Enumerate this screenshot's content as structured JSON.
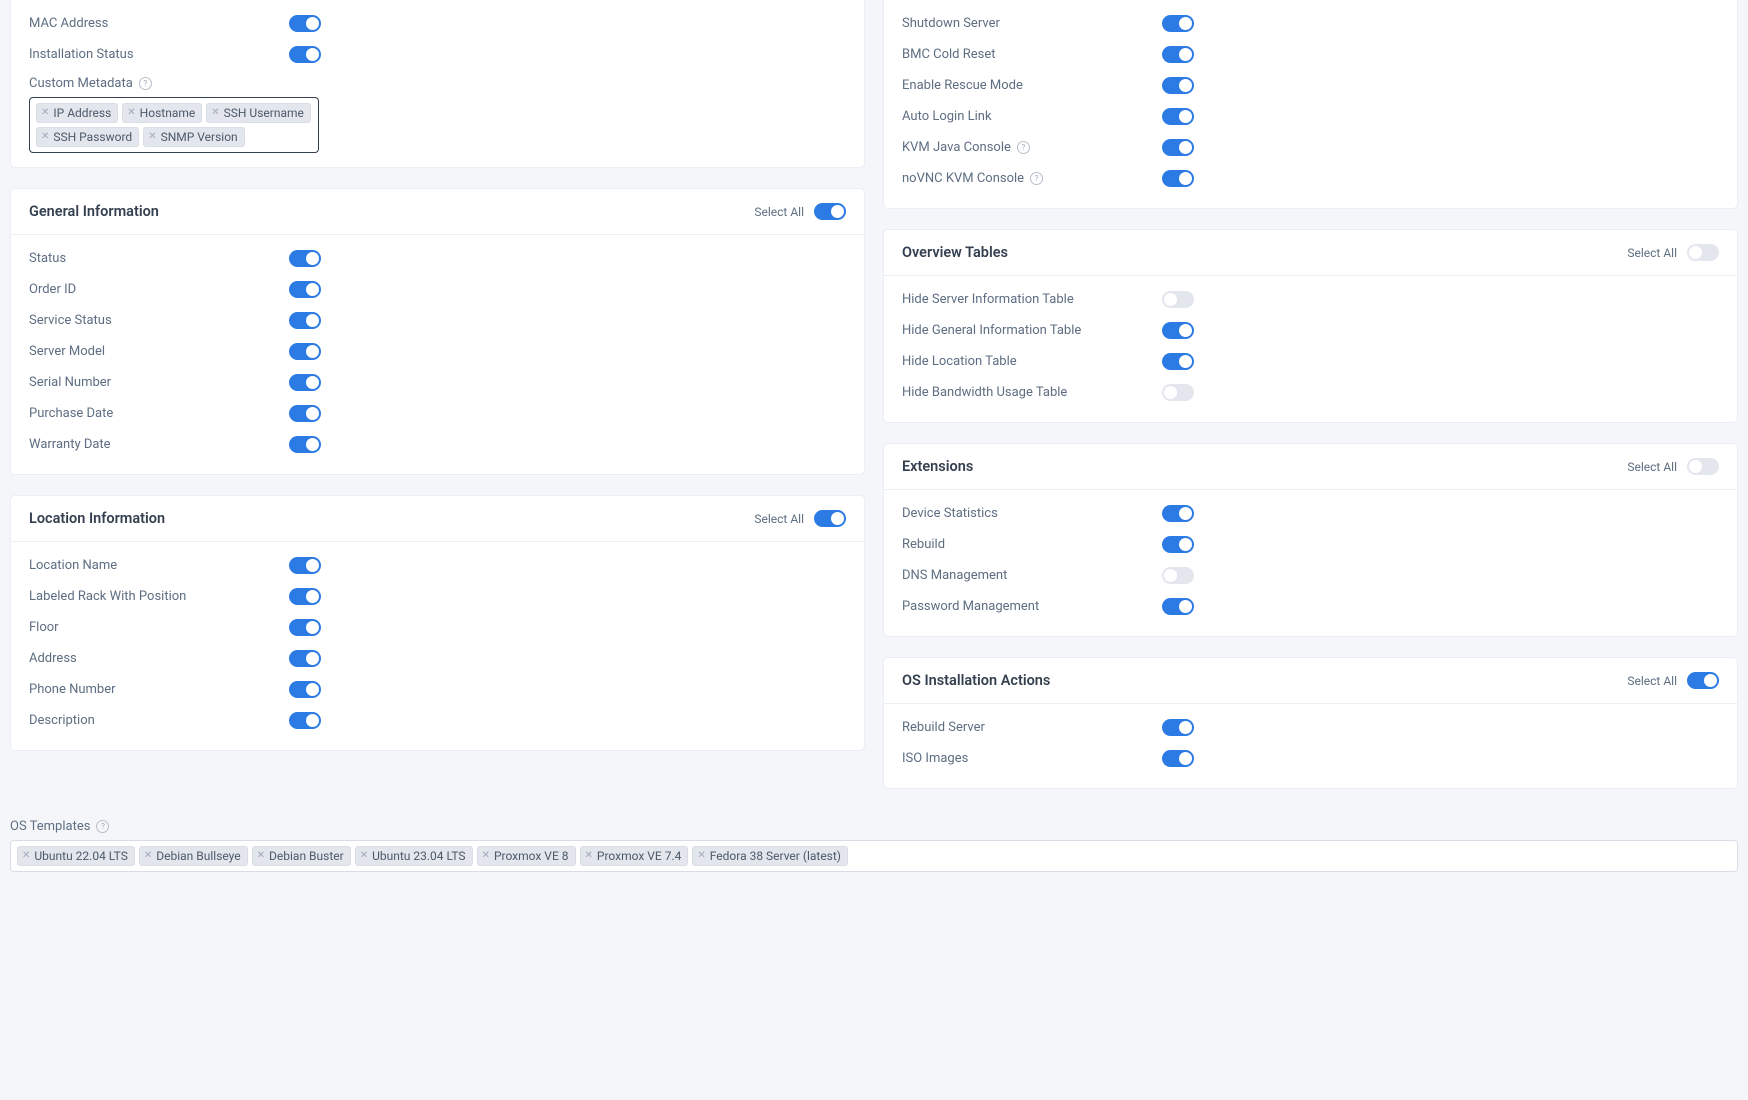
{
  "labels": {
    "select_all": "Select All",
    "custom_metadata": "Custom Metadata",
    "os_templates": "OS Templates"
  },
  "left_top": {
    "rows": [
      {
        "label": "MAC Address",
        "on": true
      },
      {
        "label": "Installation Status",
        "on": true
      }
    ],
    "tags": [
      "IP Address",
      "Hostname",
      "SSH Username",
      "SSH Password",
      "SNMP Version"
    ]
  },
  "general_info": {
    "title": "General Information",
    "select_all_on": true,
    "rows": [
      {
        "label": "Status",
        "on": true
      },
      {
        "label": "Order ID",
        "on": true
      },
      {
        "label": "Service Status",
        "on": true
      },
      {
        "label": "Server Model",
        "on": true
      },
      {
        "label": "Serial Number",
        "on": true
      },
      {
        "label": "Purchase Date",
        "on": true
      },
      {
        "label": "Warranty Date",
        "on": true
      }
    ]
  },
  "location_info": {
    "title": "Location Information",
    "select_all_on": true,
    "rows": [
      {
        "label": "Location Name",
        "on": true
      },
      {
        "label": "Labeled Rack With Position",
        "on": true
      },
      {
        "label": "Floor",
        "on": true
      },
      {
        "label": "Address",
        "on": true
      },
      {
        "label": "Phone Number",
        "on": true
      },
      {
        "label": "Description",
        "on": true
      }
    ]
  },
  "right_top": {
    "rows": [
      {
        "label": "Shutdown Server",
        "on": true,
        "help": false
      },
      {
        "label": "BMC Cold Reset",
        "on": true,
        "help": false
      },
      {
        "label": "Enable Rescue Mode",
        "on": true,
        "help": false
      },
      {
        "label": "Auto Login Link",
        "on": true,
        "help": false
      },
      {
        "label": "KVM Java Console",
        "on": true,
        "help": true
      },
      {
        "label": "noVNC KVM Console",
        "on": true,
        "help": true
      }
    ]
  },
  "overview_tables": {
    "title": "Overview Tables",
    "select_all_on": false,
    "rows": [
      {
        "label": "Hide Server Information Table",
        "on": false
      },
      {
        "label": "Hide General Information Table",
        "on": true
      },
      {
        "label": "Hide Location Table",
        "on": true
      },
      {
        "label": "Hide Bandwidth Usage Table",
        "on": false
      }
    ]
  },
  "extensions": {
    "title": "Extensions",
    "select_all_on": false,
    "rows": [
      {
        "label": "Device Statistics",
        "on": true
      },
      {
        "label": "Rebuild",
        "on": true
      },
      {
        "label": "DNS Management",
        "on": false
      },
      {
        "label": "Password Management",
        "on": true
      }
    ]
  },
  "os_actions": {
    "title": "OS Installation Actions",
    "select_all_on": true,
    "rows": [
      {
        "label": "Rebuild Server",
        "on": true
      },
      {
        "label": "ISO Images",
        "on": true
      }
    ]
  },
  "os_templates": {
    "tags": [
      "Ubuntu 22.04 LTS",
      "Debian Bullseye",
      "Debian Buster",
      "Ubuntu 23.04 LTS",
      "Proxmox VE 8",
      "Proxmox VE 7.4",
      "Fedora 38 Server (latest)"
    ]
  }
}
